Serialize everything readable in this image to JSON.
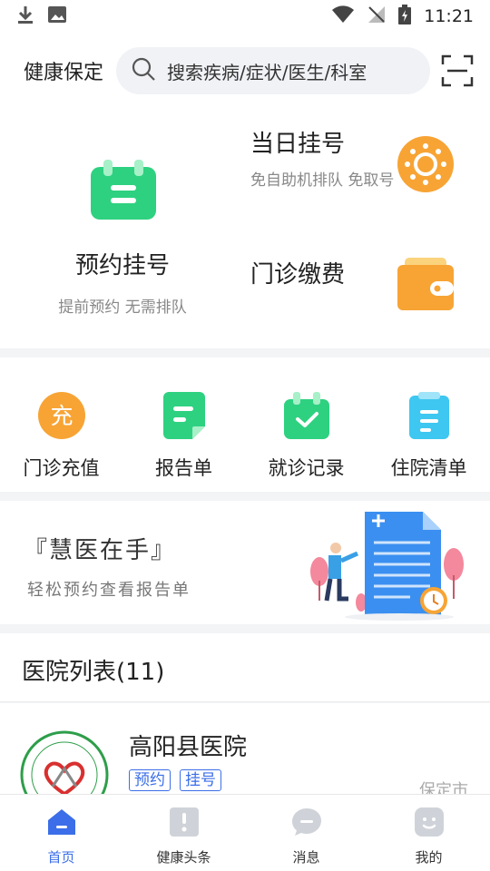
{
  "status_bar": {
    "time": "11:21"
  },
  "header": {
    "city": "健康保定",
    "search_placeholder": "搜索疾病/症状/医生/科室"
  },
  "top_services": {
    "appointment": {
      "title": "预约挂号",
      "subtitle": "提前预约 无需排队"
    },
    "same_day": {
      "title": "当日挂号",
      "subtitle": "免自助机排队 免取号"
    },
    "payment": {
      "title": "门诊缴费"
    }
  },
  "quick_actions": [
    {
      "label": "门诊充值",
      "icon": "recharge-icon",
      "glyph": "充"
    },
    {
      "label": "报告单",
      "icon": "report-icon"
    },
    {
      "label": "就诊记录",
      "icon": "visit-record-icon"
    },
    {
      "label": "住院清单",
      "icon": "inpatient-list-icon"
    }
  ],
  "banner": {
    "title": "『慧医在手』",
    "subtitle": "轻松预约查看报告单"
  },
  "hospital_list": {
    "title": "医院列表(11)",
    "items": [
      {
        "name": "高阳县医院",
        "tags": [
          "预约",
          "挂号"
        ],
        "city": "保定市"
      }
    ]
  },
  "tabbar": [
    {
      "label": "首页",
      "icon": "home-icon",
      "active": true
    },
    {
      "label": "健康头条",
      "icon": "headline-icon",
      "active": false
    },
    {
      "label": "消息",
      "icon": "message-icon",
      "active": false
    },
    {
      "label": "我的",
      "icon": "profile-icon",
      "active": false
    }
  ],
  "colors": {
    "accent": "#3b6ee8",
    "green": "#2ed180",
    "orange": "#f7a435",
    "cyan": "#3ec7f0"
  }
}
